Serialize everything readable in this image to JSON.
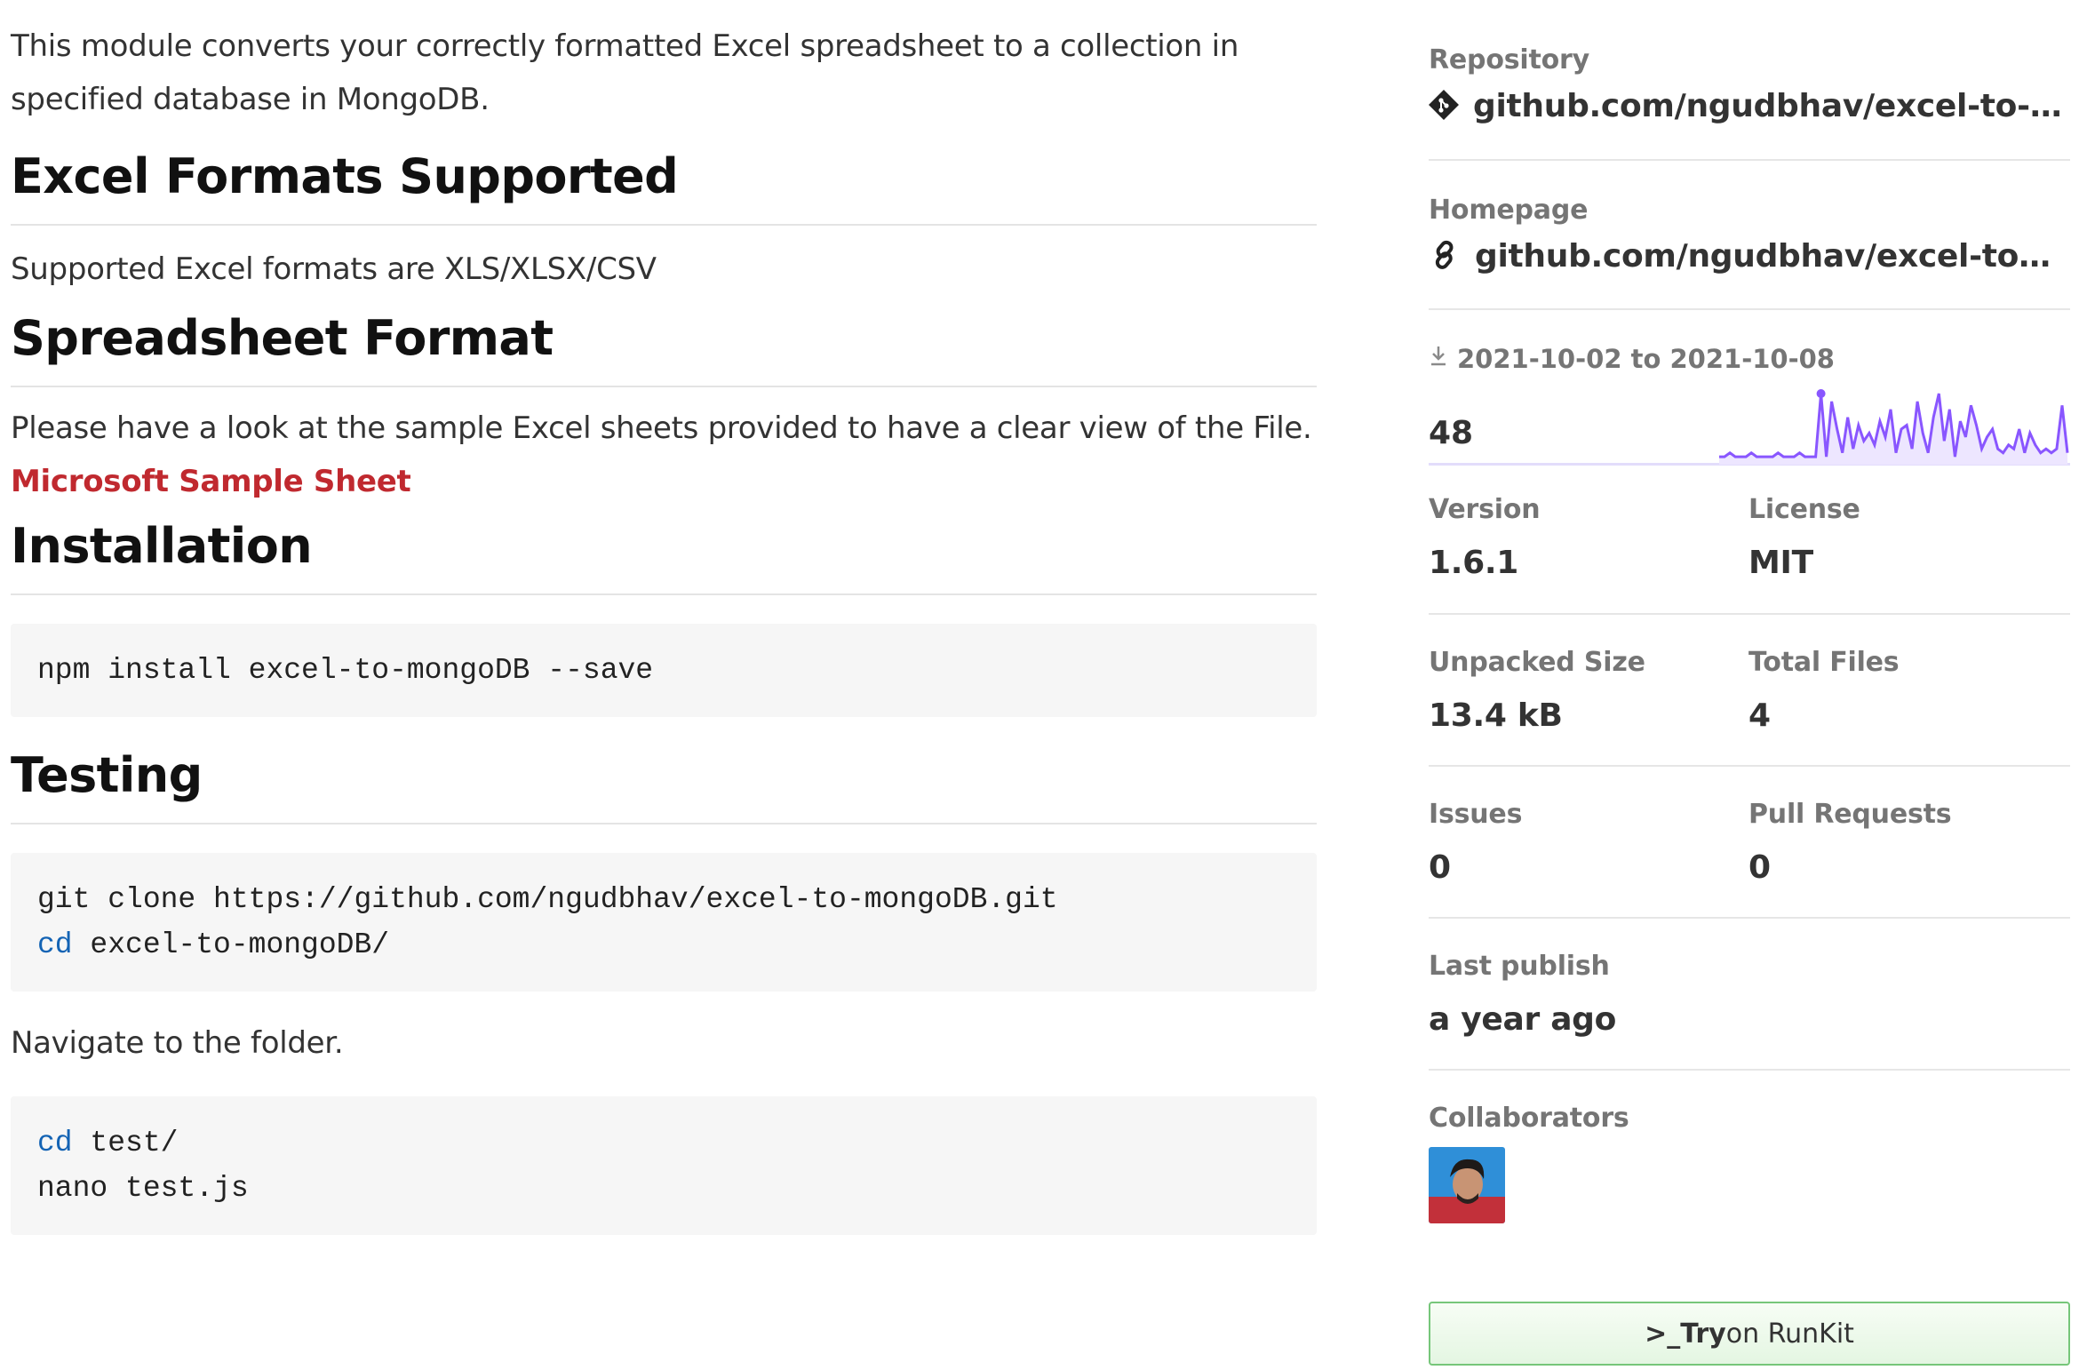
{
  "readme": {
    "intro": "This module converts your correctly formatted Excel spreadsheet to a collection in specified database in MongoDB.",
    "sections": [
      {
        "heading": "Excel Formats Supported",
        "text": "Supported Excel formats are XLS/XLSX/CSV"
      },
      {
        "heading": "Spreadsheet Format",
        "text": "Please have a look at the sample Excel sheets provided to have a clear view of the File.",
        "link": "Microsoft Sample Sheet"
      },
      {
        "heading": "Installation",
        "code": "npm install excel-to-mongoDB --save"
      },
      {
        "heading": "Testing",
        "code_line1": "git clone https://github.com/ngudbhav/excel-to-mongoDB.git",
        "code_line2_kw": "cd",
        "code_line2_rest": " excel-to-mongoDB/",
        "after_text": "Navigate to the folder.",
        "code2_line1_kw": "cd",
        "code2_line1_rest": " test/",
        "code2_line2": "nano test.js"
      }
    ]
  },
  "sidebar": {
    "repository": {
      "label": "Repository",
      "value": "github.com/ngudbhav/excel-to-mongodb",
      "icon": "git-icon"
    },
    "homepage": {
      "label": "Homepage",
      "value": "github.com/ngudbhav/excel-to-mongodb#readme",
      "icon": "link-icon"
    },
    "downloads": {
      "range": "2021-10-02 to 2021-10-08",
      "count": "48",
      "icon": "download-icon",
      "sparkline": [
        2,
        2,
        3,
        2,
        2,
        2,
        3,
        2,
        2,
        2,
        2,
        3,
        2,
        2,
        2,
        3,
        2,
        2,
        2,
        18,
        2,
        16,
        9,
        3,
        12,
        4,
        10,
        6,
        8,
        5,
        11,
        7,
        14,
        3,
        9,
        10,
        4,
        16,
        8,
        3,
        12,
        18,
        6,
        14,
        2,
        11,
        7,
        15,
        10,
        4,
        7,
        9,
        4,
        3,
        5,
        4,
        9,
        3,
        8,
        5,
        3,
        4,
        3,
        4,
        15,
        3
      ],
      "color": "#8956ff"
    },
    "version": {
      "label": "Version",
      "value": "1.6.1"
    },
    "license": {
      "label": "License",
      "value": "MIT"
    },
    "unpacked": {
      "label": "Unpacked Size",
      "value": "13.4 kB"
    },
    "files": {
      "label": "Total Files",
      "value": "4"
    },
    "issues": {
      "label": "Issues",
      "value": "0"
    },
    "pulls": {
      "label": "Pull Requests",
      "value": "0"
    },
    "last_publish": {
      "label": "Last publish",
      "value": "a year ago"
    },
    "collaborators": {
      "label": "Collaborators",
      "avatar_icon": "avatar-icon"
    },
    "runkit": {
      "prompt": ">_",
      "bold": "Try",
      "rest": " on RunKit"
    }
  }
}
